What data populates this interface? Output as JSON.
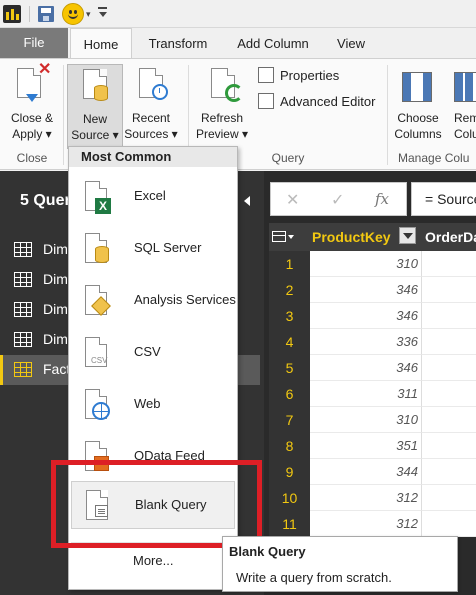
{
  "tabs": {
    "file": "File",
    "home": "Home",
    "transform": "Transform",
    "add_column": "Add Column",
    "view": "View"
  },
  "ribbon": {
    "close_apply": [
      "Close &",
      "Apply"
    ],
    "new_source": [
      "New",
      "Source"
    ],
    "recent_sources": [
      "Recent",
      "Sources"
    ],
    "refresh_preview": [
      "Refresh",
      "Preview"
    ],
    "properties": "Properties",
    "advanced_editor": "Advanced Editor",
    "choose_columns": [
      "Choose",
      "Columns"
    ],
    "remove_columns": [
      "Rem",
      "Colu"
    ],
    "groups": {
      "close": "Close",
      "query": "Query",
      "manage_columns": "Manage Colu"
    }
  },
  "menu": {
    "header": "Most Common",
    "items": [
      {
        "label": "Excel",
        "icon": "excel-icon"
      },
      {
        "label": "SQL Server",
        "icon": "sql-server-icon"
      },
      {
        "label": "Analysis Services",
        "icon": "analysis-services-icon"
      },
      {
        "label": "CSV",
        "icon": "csv-icon"
      },
      {
        "label": "Web",
        "icon": "web-icon"
      },
      {
        "label": "OData Feed",
        "icon": "odata-feed-icon"
      },
      {
        "label": "Blank Query",
        "icon": "blank-query-icon"
      }
    ],
    "more": "More..."
  },
  "tooltip": {
    "title": "Blank Query",
    "description": "Write a query from scratch."
  },
  "query_panel": {
    "title": "5 Quer",
    "items": [
      "Dim",
      "Dim",
      "Dim",
      "Dim",
      "Fact"
    ],
    "selected_index": 4
  },
  "formula_bar": {
    "cancel_symbol": "✕",
    "commit_symbol": "✓",
    "fx_symbol": "fx",
    "formula": "= Source"
  },
  "grid": {
    "columns": [
      "ProductKey",
      "OrderDa"
    ],
    "rows": [
      {
        "n": "1",
        "value": "310"
      },
      {
        "n": "2",
        "value": "346"
      },
      {
        "n": "3",
        "value": "346"
      },
      {
        "n": "4",
        "value": "336"
      },
      {
        "n": "5",
        "value": "346"
      },
      {
        "n": "6",
        "value": "311"
      },
      {
        "n": "7",
        "value": "310"
      },
      {
        "n": "8",
        "value": "351"
      },
      {
        "n": "9",
        "value": "344"
      },
      {
        "n": "10",
        "value": "312"
      },
      {
        "n": "11",
        "value": "312"
      }
    ]
  },
  "colors": {
    "accent_yellow": "#f2c811",
    "highlight_red": "#dd1f26",
    "panel_dark": "#333333"
  }
}
